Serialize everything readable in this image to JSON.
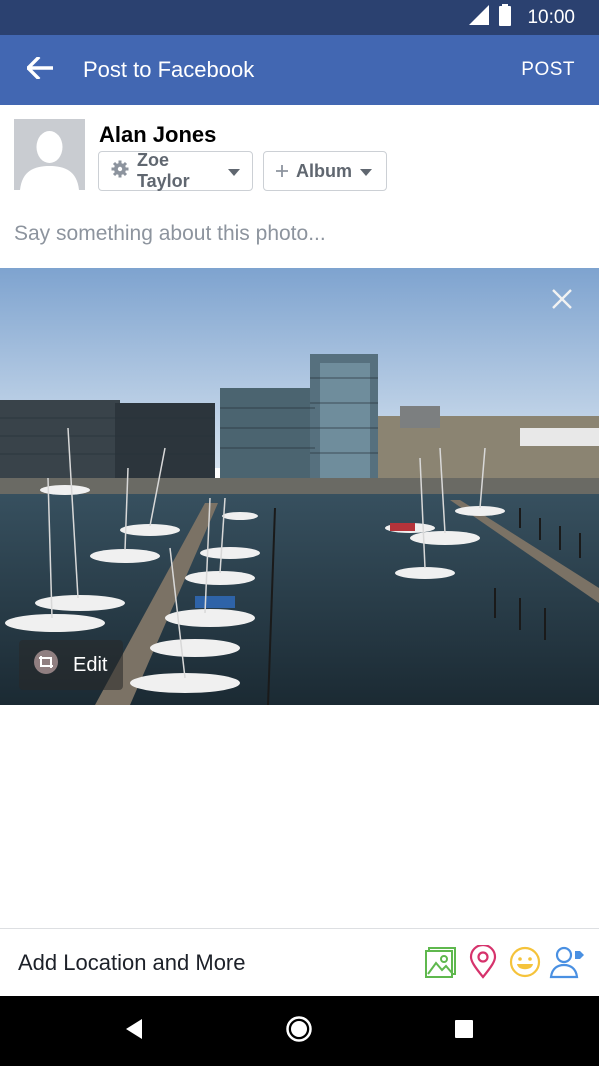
{
  "status_bar": {
    "time": "10:00",
    "icons": [
      "signal-icon",
      "battery-icon"
    ]
  },
  "app_bar": {
    "title": "Post to Facebook",
    "post_label": "POST",
    "back_icon": "back-arrow-icon"
  },
  "composer": {
    "user_name": "Alan Jones",
    "privacy_label": "Zoe Taylor",
    "album_label": "Album",
    "placeholder": "Say something about this photo..."
  },
  "photo": {
    "edit_label": "Edit",
    "remove_icon": "close-icon"
  },
  "bottom_bar": {
    "add_location_label": "Add Location and More",
    "icons": [
      "photo-icon",
      "location-pin-icon",
      "feeling-icon",
      "tag-people-icon"
    ]
  },
  "colors": {
    "header": "#4267b2",
    "status_bar": "#2b4170",
    "photo_icon": "#5fb84e",
    "location_icon": "#d6336c",
    "feeling_icon": "#f5c33b",
    "tag_icon": "#4a90e2"
  }
}
